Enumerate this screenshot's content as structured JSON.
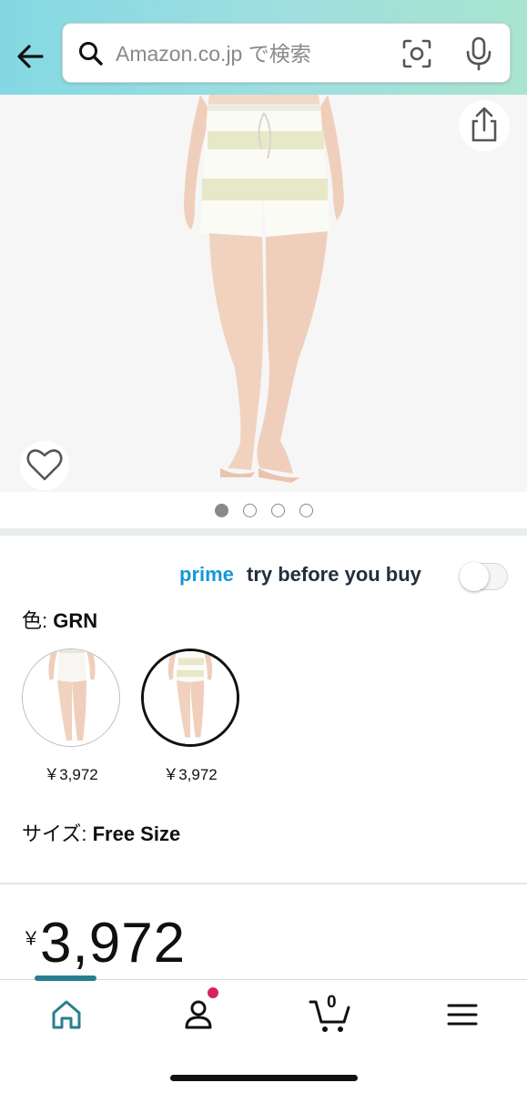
{
  "header": {
    "search_placeholder": "Amazon.co.jp で検索",
    "icons": [
      "back-arrow-icon",
      "search-icon",
      "camera-scan-icon",
      "microphone-icon"
    ]
  },
  "gallery": {
    "image_count": 4,
    "active_index": 0,
    "icons": [
      "share-icon",
      "heart-icon"
    ]
  },
  "prime_try": {
    "prime_label": "prime",
    "tail_label": "try before you buy",
    "enabled": false
  },
  "variation": {
    "color_prefix": "色: ",
    "color_value": "GRN",
    "swatches": [
      {
        "price": "￥3,972",
        "selected": false
      },
      {
        "price": "￥3,972",
        "selected": true
      }
    ],
    "size_prefix": "サイズ: ",
    "size_value": "Free Size"
  },
  "pricing": {
    "currency": "￥",
    "amount": "3,972"
  },
  "tabbar": {
    "cart_count": "0",
    "active_tab": "home",
    "icons": [
      "home-icon",
      "account-icon",
      "cart-icon",
      "menu-icon"
    ]
  },
  "colors": {
    "header_gradient_start": "#84d8e3",
    "header_gradient_end": "#a8e4cf",
    "prime_blue": "#1399d6",
    "active_tab_teal": "#2a7e8f",
    "notification_pink": "#d6245b"
  }
}
